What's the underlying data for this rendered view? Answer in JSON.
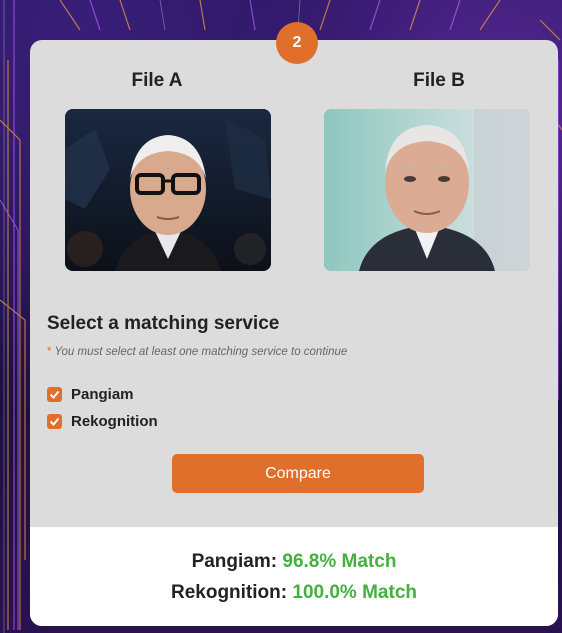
{
  "step_badge": "2",
  "file_a": {
    "label": "File A",
    "image": "older man with white hair wearing black glasses at night event"
  },
  "file_b": {
    "label": "File B",
    "image": "older man with white hair in dark suit smiling slightly"
  },
  "service": {
    "title": "Select a matching service",
    "hint_star": "*",
    "hint": "You must select at least one matching service to continue",
    "options": [
      {
        "label": "Pangiam",
        "checked": true
      },
      {
        "label": "Rekognition",
        "checked": true
      }
    ]
  },
  "compare_label": "Compare",
  "results": [
    {
      "name": "Pangiam:",
      "value": "96.8% Match"
    },
    {
      "name": "Rekognition:",
      "value": "100.0% Match"
    }
  ],
  "colors": {
    "accent": "#e06f2c",
    "match": "#44b03e",
    "panel": "#dcdcdc"
  }
}
